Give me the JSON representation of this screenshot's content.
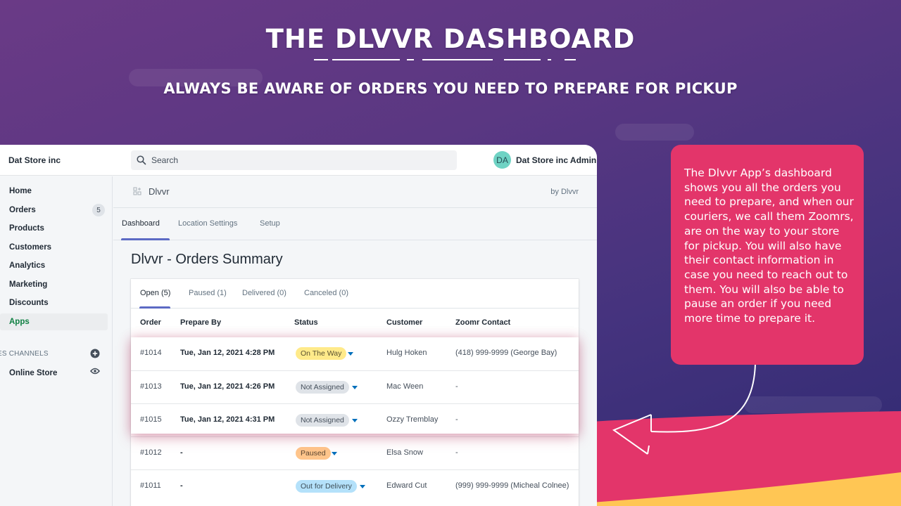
{
  "hero": {
    "title": "THE DLVVR DASHBOARD",
    "subtitle": "ALWAYS BE AWARE OF ORDERS YOU NEED TO PREPARE FOR PICKUP"
  },
  "topbar": {
    "store_name": "Dat Store inc",
    "search_placeholder": "Search",
    "avatar_initials": "DA",
    "admin_name": "Dat Store inc Admin"
  },
  "sidebar": {
    "items": [
      {
        "label": "Home"
      },
      {
        "label": "Orders",
        "badge": "5"
      },
      {
        "label": "Products"
      },
      {
        "label": "Customers"
      },
      {
        "label": "Analytics"
      },
      {
        "label": "Marketing"
      },
      {
        "label": "Discounts"
      },
      {
        "label": "Apps",
        "active": true
      }
    ],
    "section_label": "ES CHANNELS",
    "channels": [
      {
        "label": "Online Store"
      }
    ]
  },
  "app_header": {
    "title": "Dlvvr",
    "by": "by Dlvvr"
  },
  "tabs": [
    {
      "label": "Dashboard",
      "active": true
    },
    {
      "label": "Location Settings"
    },
    {
      "label": "Setup"
    }
  ],
  "page_title": "Dlvvr - Orders Summary",
  "order_tabs": [
    {
      "label": "Open (5)",
      "active": true
    },
    {
      "label": "Paused (1)"
    },
    {
      "label": "Delivered (0)"
    },
    {
      "label": "Canceled (0)"
    }
  ],
  "table": {
    "headers": [
      "Order",
      "Prepare By",
      "Status",
      "Customer",
      "Zoomr Contact"
    ],
    "rows": [
      {
        "order": "#1014",
        "prepare_by": "Tue, Jan 12, 2021 4:28 PM",
        "status": "On The Way",
        "status_bg": "#ffea8a",
        "status_fg": "#595130",
        "customer": "Hulg Hoken",
        "contact": "(418) 999-9999 (George Bay)"
      },
      {
        "order": "#1013",
        "prepare_by": "Tue, Jan 12, 2021 4:26 PM",
        "status": "Not Assigned",
        "status_bg": "#dfe3e8",
        "status_fg": "#454f5b",
        "customer": "Mac Ween",
        "contact": "-"
      },
      {
        "order": "#1015",
        "prepare_by": "Tue, Jan 12, 2021 4:31 PM",
        "status": "Not Assigned",
        "status_bg": "#dfe3e8",
        "status_fg": "#454f5b",
        "customer": "Ozzy Tremblay",
        "contact": "-"
      },
      {
        "order": "#1012",
        "prepare_by": "-",
        "status": "Paused",
        "status_bg": "#ffc58b",
        "status_fg": "#594430",
        "customer": "Elsa Snow",
        "contact": "-"
      },
      {
        "order": "#1011",
        "prepare_by": "-",
        "status": "Out for Delivery",
        "status_bg": "#b4e1fa",
        "status_fg": "#3e4e57",
        "customer": "Edward Cut",
        "contact": "(999) 999-9999 (Micheal Colnee)"
      }
    ]
  },
  "callout": {
    "text": "The Dlvvr App’s dashboard shows you all the orders you need to prepare, and when our couriers, we call them Zoomrs, are on the way to your store for pickup. You will also have their contact information in case you need to reach out to them. You will also be able to pause an order if you need more time to prepare it."
  },
  "colors": {
    "accent_pink": "#e3356a",
    "accent_yellow": "#ffc654",
    "navy": "#2f2a72",
    "tab_underline": "#5c6ac4",
    "apps_green": "#108043"
  }
}
